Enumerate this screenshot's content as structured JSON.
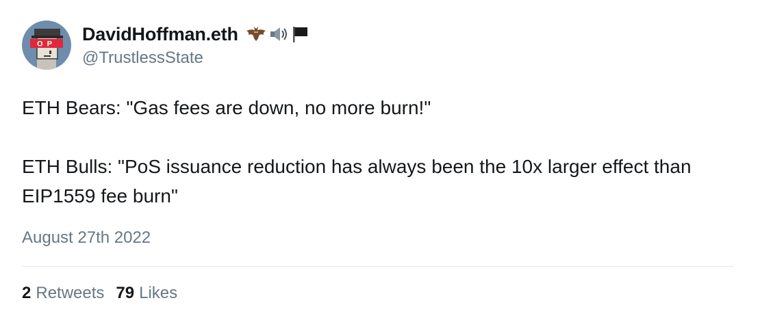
{
  "author": {
    "display_name": "DavidHoffman.eth",
    "handle": "@TrustlessState",
    "avatar_visor_text": "OP",
    "name_emojis": [
      "bat-emoji",
      "speaker-emoji",
      "black-flag-emoji"
    ]
  },
  "tweet": {
    "paragraphs": [
      "ETH Bears: \"Gas fees are down, no more burn!\"",
      "ETH Bulls: \"PoS issuance reduction has always been the 10x larger effect than EIP1559 fee burn\""
    ],
    "date": "August 27th 2022"
  },
  "stats": {
    "retweets_count": "2",
    "retweets_label": "Retweets",
    "likes_count": "79",
    "likes_label": "Likes"
  },
  "colors": {
    "text_primary": "#14171a",
    "text_secondary": "#657786",
    "divider": "#e1e8ed",
    "avatar_bg": "#6e8dad",
    "visor_red": "#e0283a"
  }
}
